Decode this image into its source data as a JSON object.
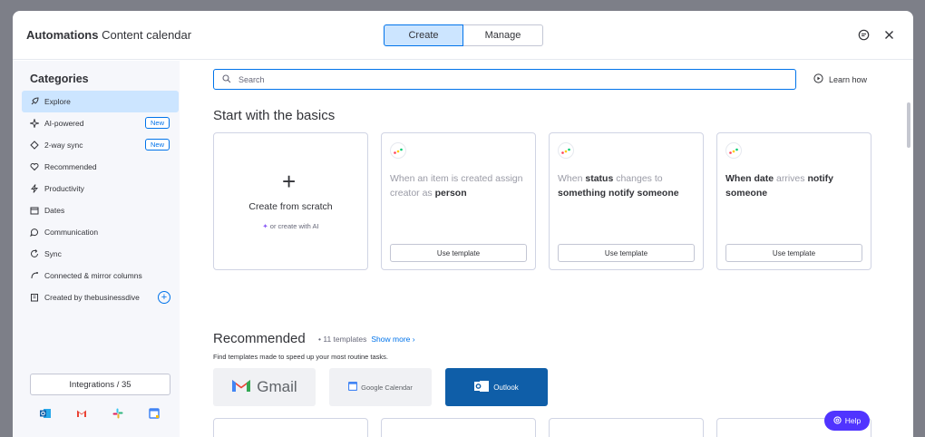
{
  "header": {
    "title_bold": "Automations",
    "title_light": "Content calendar",
    "tabs": [
      {
        "label": "Create",
        "active": true
      },
      {
        "label": "Manage",
        "active": false
      }
    ],
    "icons": [
      "feedback-icon",
      "close-icon"
    ]
  },
  "sidebar": {
    "title": "Categories",
    "items": [
      {
        "label": "Explore",
        "icon": "rocket-icon",
        "active": true
      },
      {
        "label": "AI-powered",
        "icon": "sparkle-icon",
        "badge": "New"
      },
      {
        "label": "2-way sync",
        "icon": "sync-icon",
        "badge": "New"
      },
      {
        "label": "Recommended",
        "icon": "heart-icon"
      },
      {
        "label": "Productivity",
        "icon": "bolt-icon"
      },
      {
        "label": "Dates",
        "icon": "calendar-icon"
      },
      {
        "label": "Communication",
        "icon": "chat-icon"
      },
      {
        "label": "Sync",
        "icon": "refresh-icon"
      },
      {
        "label": "Connected & mirror columns",
        "icon": "link-icon"
      },
      {
        "label": "Created by thebusinessdive",
        "icon": "building-icon"
      }
    ],
    "integrations_label": "Integrations / 35",
    "integration_icons": [
      "outlook-icon",
      "gmail-icon",
      "slack-icon",
      "google-calendar-icon"
    ]
  },
  "main": {
    "search_placeholder": "Search",
    "learn_how": "Learn how",
    "basics_title": "Start with the basics",
    "scratch": {
      "label": "Create from scratch",
      "ai": "or create with AI"
    },
    "use_template": "Use template",
    "recommended_title": "Recommended",
    "recommended_count": "11 templates",
    "show_more": "Show more",
    "recommended_sub": "Find templates made to speed up your most routine tasks.",
    "tiles": {
      "gmail": "Gmail",
      "gcal": "Google Calendar",
      "outlook": "Outlook"
    },
    "help": "Help"
  },
  "colors": {
    "accent": "#0073ea",
    "active_bg": "#cce5ff",
    "help": "#5034ff",
    "outlook": "#0f5ea8"
  }
}
